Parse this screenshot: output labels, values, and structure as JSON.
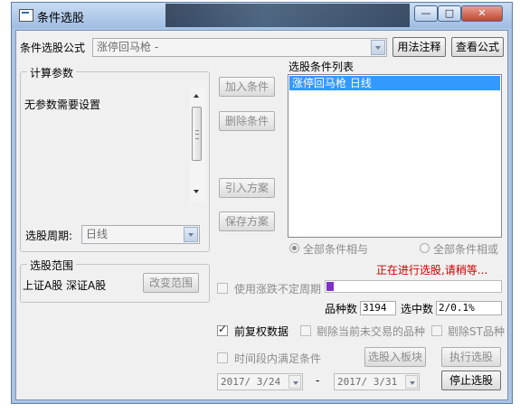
{
  "window": {
    "title": "条件选股",
    "min_glyph": "—",
    "max_glyph": "□",
    "close_glyph": "✕"
  },
  "formula": {
    "label": "条件选股公式",
    "value": "涨停回马枪  -",
    "usage_button": "用法注释",
    "view_button": "查看公式"
  },
  "params": {
    "group_title": "计算参数",
    "text": "无参数需要设置",
    "period_label": "选股周期:",
    "period_value": "日线"
  },
  "actions": {
    "add": "加入条件",
    "delete": "删除条件",
    "import": "引入方案",
    "save": "保存方案"
  },
  "condition_list": {
    "title": "选股条件列表",
    "items": [
      "涨停回马枪  日线"
    ]
  },
  "logic": {
    "and_label": "全部条件相与",
    "or_label": "全部条件相或"
  },
  "status": {
    "running_text": "正在进行选股,请稍等...",
    "running_color": "#cc0000"
  },
  "scope": {
    "group_title": "选股范围",
    "text": "上证A股 深证A股",
    "change_button": "改变范围"
  },
  "options": {
    "variable_period": "使用涨跌不定周期",
    "pre_adjust": "前复权数据",
    "exclude_untraded": "剔除当前未交易的品种",
    "exclude_st": "剔除ST品种",
    "time_range": "时间段内满足条件"
  },
  "progress": {
    "fraction": 0.04
  },
  "stats": {
    "count_label": "品种数",
    "count_value": "3194",
    "selected_label": "选中数",
    "selected_value": "2/0.1%"
  },
  "dates": {
    "start": "2017/ 3/24",
    "separator": "-",
    "end": "2017/ 3/31"
  },
  "bottom_buttons": {
    "to_block": "选股入板块",
    "execute": "执行选股",
    "stop": "停止选股"
  }
}
